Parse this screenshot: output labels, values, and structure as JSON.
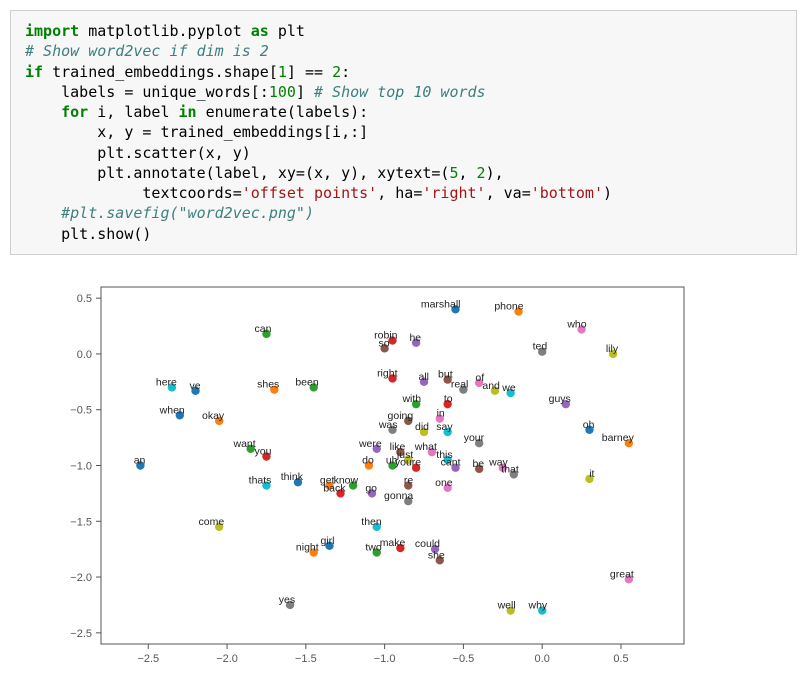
{
  "code": {
    "lines": [
      {
        "t": "kw",
        "s": "import"
      },
      {
        "t": "sp",
        "s": " "
      },
      {
        "t": "nm",
        "s": "matplotlib.pyplot "
      },
      {
        "t": "kw",
        "s": "as"
      },
      {
        "t": "sp",
        "s": " "
      },
      {
        "t": "nm",
        "s": "plt"
      },
      {
        "t": "br"
      },
      {
        "t": "cm",
        "s": "# Show word2vec if dim is 2"
      },
      {
        "t": "br"
      },
      {
        "t": "kw",
        "s": "if"
      },
      {
        "t": "sp",
        "s": " "
      },
      {
        "t": "nm",
        "s": "trained_embeddings.shape["
      },
      {
        "t": "num",
        "s": "1"
      },
      {
        "t": "nm",
        "s": "] == "
      },
      {
        "t": "num",
        "s": "2"
      },
      {
        "t": "nm",
        "s": ":"
      },
      {
        "t": "br"
      },
      {
        "t": "sp",
        "s": "    "
      },
      {
        "t": "nm",
        "s": "labels = unique_words[:"
      },
      {
        "t": "num",
        "s": "100"
      },
      {
        "t": "nm",
        "s": "] "
      },
      {
        "t": "cm",
        "s": "# Show top 10 words"
      },
      {
        "t": "br"
      },
      {
        "t": "sp",
        "s": "    "
      },
      {
        "t": "kw",
        "s": "for"
      },
      {
        "t": "sp",
        "s": " "
      },
      {
        "t": "nm",
        "s": "i, label "
      },
      {
        "t": "kw",
        "s": "in"
      },
      {
        "t": "sp",
        "s": " "
      },
      {
        "t": "nm",
        "s": "enumerate(labels):"
      },
      {
        "t": "br"
      },
      {
        "t": "sp",
        "s": "        "
      },
      {
        "t": "nm",
        "s": "x, y = trained_embeddings[i,:]"
      },
      {
        "t": "br"
      },
      {
        "t": "sp",
        "s": "        "
      },
      {
        "t": "nm",
        "s": "plt.scatter(x, y)"
      },
      {
        "t": "br"
      },
      {
        "t": "sp",
        "s": "        "
      },
      {
        "t": "nm",
        "s": "plt.annotate(label, xy=(x, y), xytext=("
      },
      {
        "t": "num",
        "s": "5"
      },
      {
        "t": "nm",
        "s": ", "
      },
      {
        "t": "num",
        "s": "2"
      },
      {
        "t": "nm",
        "s": "),"
      },
      {
        "t": "br"
      },
      {
        "t": "sp",
        "s": "             "
      },
      {
        "t": "nm",
        "s": "textcoords="
      },
      {
        "t": "str",
        "s": "'offset points'"
      },
      {
        "t": "nm",
        "s": ", ha="
      },
      {
        "t": "str",
        "s": "'right'"
      },
      {
        "t": "nm",
        "s": ", va="
      },
      {
        "t": "str",
        "s": "'bottom'"
      },
      {
        "t": "nm",
        "s": ")"
      },
      {
        "t": "br"
      },
      {
        "t": "sp",
        "s": "    "
      },
      {
        "t": "cm",
        "s": "#plt.savefig(\"word2vec.png\")"
      },
      {
        "t": "br"
      },
      {
        "t": "sp",
        "s": "    "
      },
      {
        "t": "nm",
        "s": "plt.show()"
      }
    ]
  },
  "chart_data": {
    "type": "scatter",
    "title": "",
    "xlabel": "",
    "ylabel": "",
    "xlim": [
      -2.8,
      0.9
    ],
    "ylim": [
      -2.6,
      0.6
    ],
    "xticks": [
      -2.5,
      -2.0,
      -1.5,
      -1.0,
      -0.5,
      0.0,
      0.5
    ],
    "yticks": [
      -2.5,
      -2.0,
      -1.5,
      -1.0,
      -0.5,
      0.0,
      0.5
    ],
    "colors": [
      "#1f77b4",
      "#ff7f0e",
      "#2ca02c",
      "#d62728",
      "#9467bd",
      "#8c564b",
      "#e377c2",
      "#7f7f7f",
      "#bcbd22",
      "#17becf"
    ],
    "points": [
      {
        "label": "marshall",
        "x": -0.55,
        "y": 0.4
      },
      {
        "label": "phone",
        "x": -0.15,
        "y": 0.38
      },
      {
        "label": "can",
        "x": -1.75,
        "y": 0.18
      },
      {
        "label": "robin",
        "x": -0.95,
        "y": 0.12
      },
      {
        "label": "he",
        "x": -0.8,
        "y": 0.1
      },
      {
        "label": "so",
        "x": -1.0,
        "y": 0.05
      },
      {
        "label": "who",
        "x": 0.25,
        "y": 0.22
      },
      {
        "label": "ted",
        "x": 0.0,
        "y": 0.02
      },
      {
        "label": "lily",
        "x": 0.45,
        "y": 0.0
      },
      {
        "label": "here",
        "x": -2.35,
        "y": -0.3
      },
      {
        "label": "ve",
        "x": -2.2,
        "y": -0.33
      },
      {
        "label": "shes",
        "x": -1.7,
        "y": -0.32
      },
      {
        "label": "been",
        "x": -1.45,
        "y": -0.3
      },
      {
        "label": "right",
        "x": -0.95,
        "y": -0.22
      },
      {
        "label": "all",
        "x": -0.75,
        "y": -0.25
      },
      {
        "label": "but",
        "x": -0.6,
        "y": -0.23
      },
      {
        "label": "of",
        "x": -0.4,
        "y": -0.26
      },
      {
        "label": "real",
        "x": -0.5,
        "y": -0.32
      },
      {
        "label": "and",
        "x": -0.3,
        "y": -0.33
      },
      {
        "label": "we",
        "x": -0.2,
        "y": -0.35
      },
      {
        "label": "when",
        "x": -2.3,
        "y": -0.55
      },
      {
        "label": "okay",
        "x": -2.05,
        "y": -0.6
      },
      {
        "label": "with",
        "x": -0.8,
        "y": -0.45
      },
      {
        "label": "to",
        "x": -0.6,
        "y": -0.45
      },
      {
        "label": "guys",
        "x": 0.15,
        "y": -0.45
      },
      {
        "label": "going",
        "x": -0.85,
        "y": -0.6
      },
      {
        "label": "in",
        "x": -0.65,
        "y": -0.58
      },
      {
        "label": "was",
        "x": -0.95,
        "y": -0.68
      },
      {
        "label": "did",
        "x": -0.75,
        "y": -0.7
      },
      {
        "label": "say",
        "x": -0.6,
        "y": -0.7
      },
      {
        "label": "oh",
        "x": 0.3,
        "y": -0.68
      },
      {
        "label": "barney",
        "x": 0.55,
        "y": -0.8
      },
      {
        "label": "want",
        "x": -1.85,
        "y": -0.85
      },
      {
        "label": "you",
        "x": -1.75,
        "y": -0.92
      },
      {
        "label": "were",
        "x": -1.05,
        "y": -0.85
      },
      {
        "label": "like",
        "x": -0.9,
        "y": -0.88
      },
      {
        "label": "what",
        "x": -0.7,
        "y": -0.88
      },
      {
        "label": "your",
        "x": -0.4,
        "y": -0.8
      },
      {
        "label": "just",
        "x": -0.85,
        "y": -0.95
      },
      {
        "label": "this",
        "x": -0.6,
        "y": -0.95
      },
      {
        "label": "an",
        "x": -2.55,
        "y": -1.0
      },
      {
        "label": "do",
        "x": -1.1,
        "y": -1.0
      },
      {
        "label": "uh",
        "x": -0.95,
        "y": -1.0
      },
      {
        "label": "youre",
        "x": -0.8,
        "y": -1.02
      },
      {
        "label": "cant",
        "x": -0.55,
        "y": -1.02
      },
      {
        "label": "be",
        "x": -0.4,
        "y": -1.03
      },
      {
        "label": "way",
        "x": -0.25,
        "y": -1.02
      },
      {
        "label": "that",
        "x": -0.18,
        "y": -1.08
      },
      {
        "label": "it",
        "x": 0.3,
        "y": -1.12
      },
      {
        "label": "thats",
        "x": -1.75,
        "y": -1.18
      },
      {
        "label": "think",
        "x": -1.55,
        "y": -1.15
      },
      {
        "label": "get",
        "x": -1.35,
        "y": -1.18
      },
      {
        "label": "know",
        "x": -1.2,
        "y": -1.18
      },
      {
        "label": "back",
        "x": -1.28,
        "y": -1.25
      },
      {
        "label": "go",
        "x": -1.08,
        "y": -1.25
      },
      {
        "label": "re",
        "x": -0.85,
        "y": -1.18
      },
      {
        "label": "one",
        "x": -0.6,
        "y": -1.2
      },
      {
        "label": "gonna",
        "x": -0.85,
        "y": -1.32
      },
      {
        "label": "come",
        "x": -2.05,
        "y": -1.55
      },
      {
        "label": "then",
        "x": -1.05,
        "y": -1.55
      },
      {
        "label": "girl",
        "x": -1.35,
        "y": -1.72
      },
      {
        "label": "night",
        "x": -1.45,
        "y": -1.78
      },
      {
        "label": "two",
        "x": -1.05,
        "y": -1.78
      },
      {
        "label": "make",
        "x": -0.9,
        "y": -1.74
      },
      {
        "label": "could",
        "x": -0.68,
        "y": -1.75
      },
      {
        "label": "she",
        "x": -0.65,
        "y": -1.85
      },
      {
        "label": "great",
        "x": 0.55,
        "y": -2.02
      },
      {
        "label": "yes",
        "x": -1.6,
        "y": -2.25
      },
      {
        "label": "well",
        "x": -0.2,
        "y": -2.3
      },
      {
        "label": "why",
        "x": 0.0,
        "y": -2.3
      }
    ]
  }
}
